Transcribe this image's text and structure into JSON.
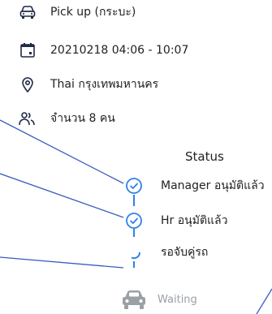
{
  "details": {
    "vehicle": "Pick up (กระบะ)",
    "datetime": "20210218 04:06 - 10:07",
    "location": "Thai  กรุงเทพมหานคร",
    "passengers": "จำนวน 8 คน"
  },
  "status": {
    "title": "Status",
    "steps": [
      {
        "label": "Manager อนุมัติแล้ว",
        "state": "done"
      },
      {
        "label": "Hr อนุมัติแล้ว",
        "state": "done"
      },
      {
        "label": "รอจับคู่รถ",
        "state": "in-progress"
      },
      {
        "label": "Waiting",
        "state": "pending"
      }
    ]
  },
  "colors": {
    "accent": "#2f80ed",
    "icon": "#1f2a44",
    "muted": "#9aa0a6"
  }
}
